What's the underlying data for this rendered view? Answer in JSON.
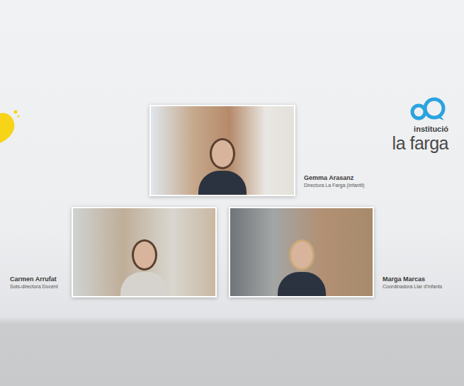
{
  "logo": {
    "line1": "institució",
    "line2": "la farga"
  },
  "participants": [
    {
      "name": "Gemma Arasanz",
      "role": "Directora La Farga (Infantil)"
    },
    {
      "name": "Carmen Arrufat",
      "role": "Sots-directora Docent"
    },
    {
      "name": "Marga Marcas",
      "role": "Coordinadora Llar d'Infants"
    }
  ]
}
